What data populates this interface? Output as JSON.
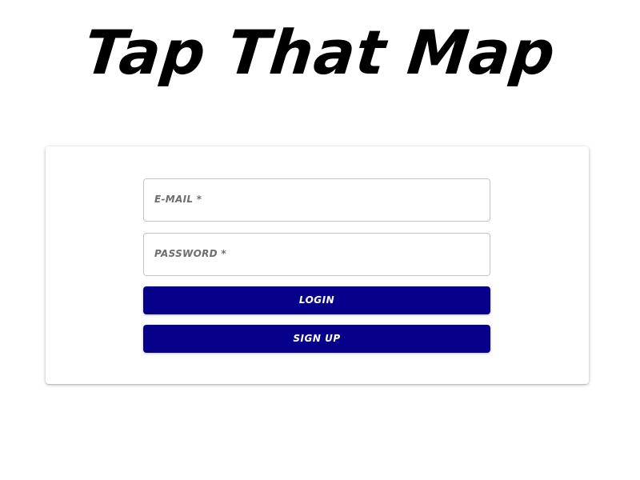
{
  "app": {
    "title": "Tap That Map"
  },
  "login_form": {
    "email_label": "E-mail *",
    "password_label": "Password *",
    "login_label": "Login",
    "signup_label": "Sign Up"
  },
  "colors": {
    "button_background": "#06008b",
    "button_text": "#ffffff",
    "field_border": "#c4c4c4",
    "label_text": "#6e6e6e",
    "page_background": "#ffffff"
  }
}
